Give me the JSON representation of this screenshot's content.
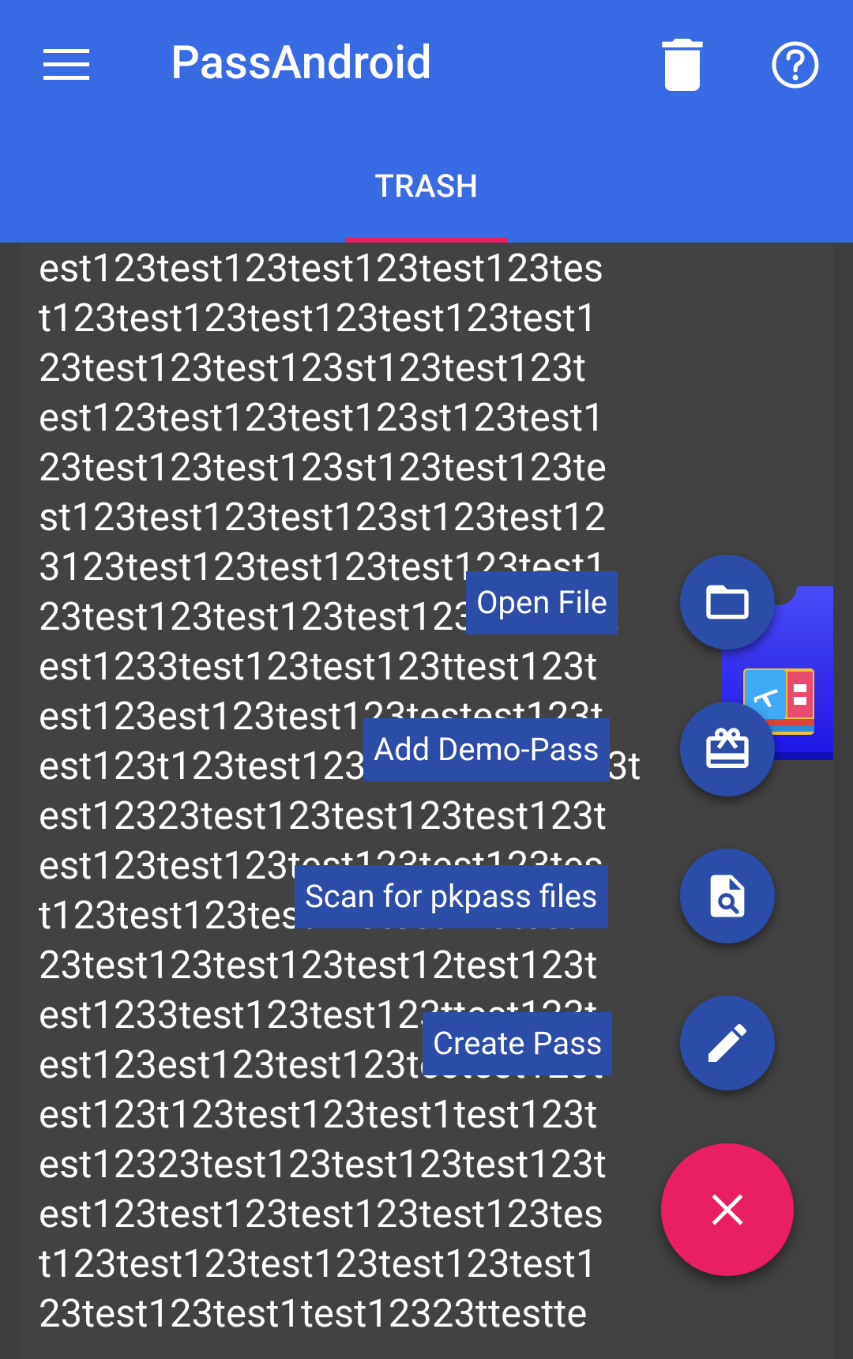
{
  "app": {
    "title": "PassAndroid",
    "accent_color": "#366be4",
    "icons": {
      "menu": "menu-icon",
      "trash": "trash-icon",
      "help": "help-icon"
    }
  },
  "tabs": [
    {
      "label": "TRASH",
      "selected": true,
      "indicator_color": "#e91e63"
    }
  ],
  "pass_card": {
    "text": "est123test123test123test123tes\nt123test123test123test123test1\n23test123test123st123test123t\nest123test123test123st123test1\n23test123test123st123test123te\nst123test123test123st123test12\n3123test123test123test123test1\n23test123test123test123test123t\nest1233test123test123ttest123t\nest123est123test123testest123t\nest123t123test123test123test123t\nest12323test123test123test123t\nest123test123test123test123tes\nt123test123test123test123test1\n23test123test123test12test123t\nest1233test123test123ttest123t\nest123est123test123testest123t\nest123t123test123test1test123t\nest12323test123test123test123t\nest123test123test123test123tes\nt123test123test123test123test1\n23test123test1test12323ttestte",
    "thumbnail_icon": "boarding-pass-icon"
  },
  "fab_menu": {
    "items": [
      {
        "label": "Open File",
        "icon": "folder-icon"
      },
      {
        "label": "Add Demo-Pass",
        "icon": "gift-card-icon"
      },
      {
        "label": "Scan for pkpass files",
        "icon": "file-search-icon"
      },
      {
        "label": "Create Pass",
        "icon": "pencil-icon"
      }
    ],
    "item_color": "#2b4da8",
    "main_icon": "close-icon",
    "main_color": "#e91e63"
  }
}
